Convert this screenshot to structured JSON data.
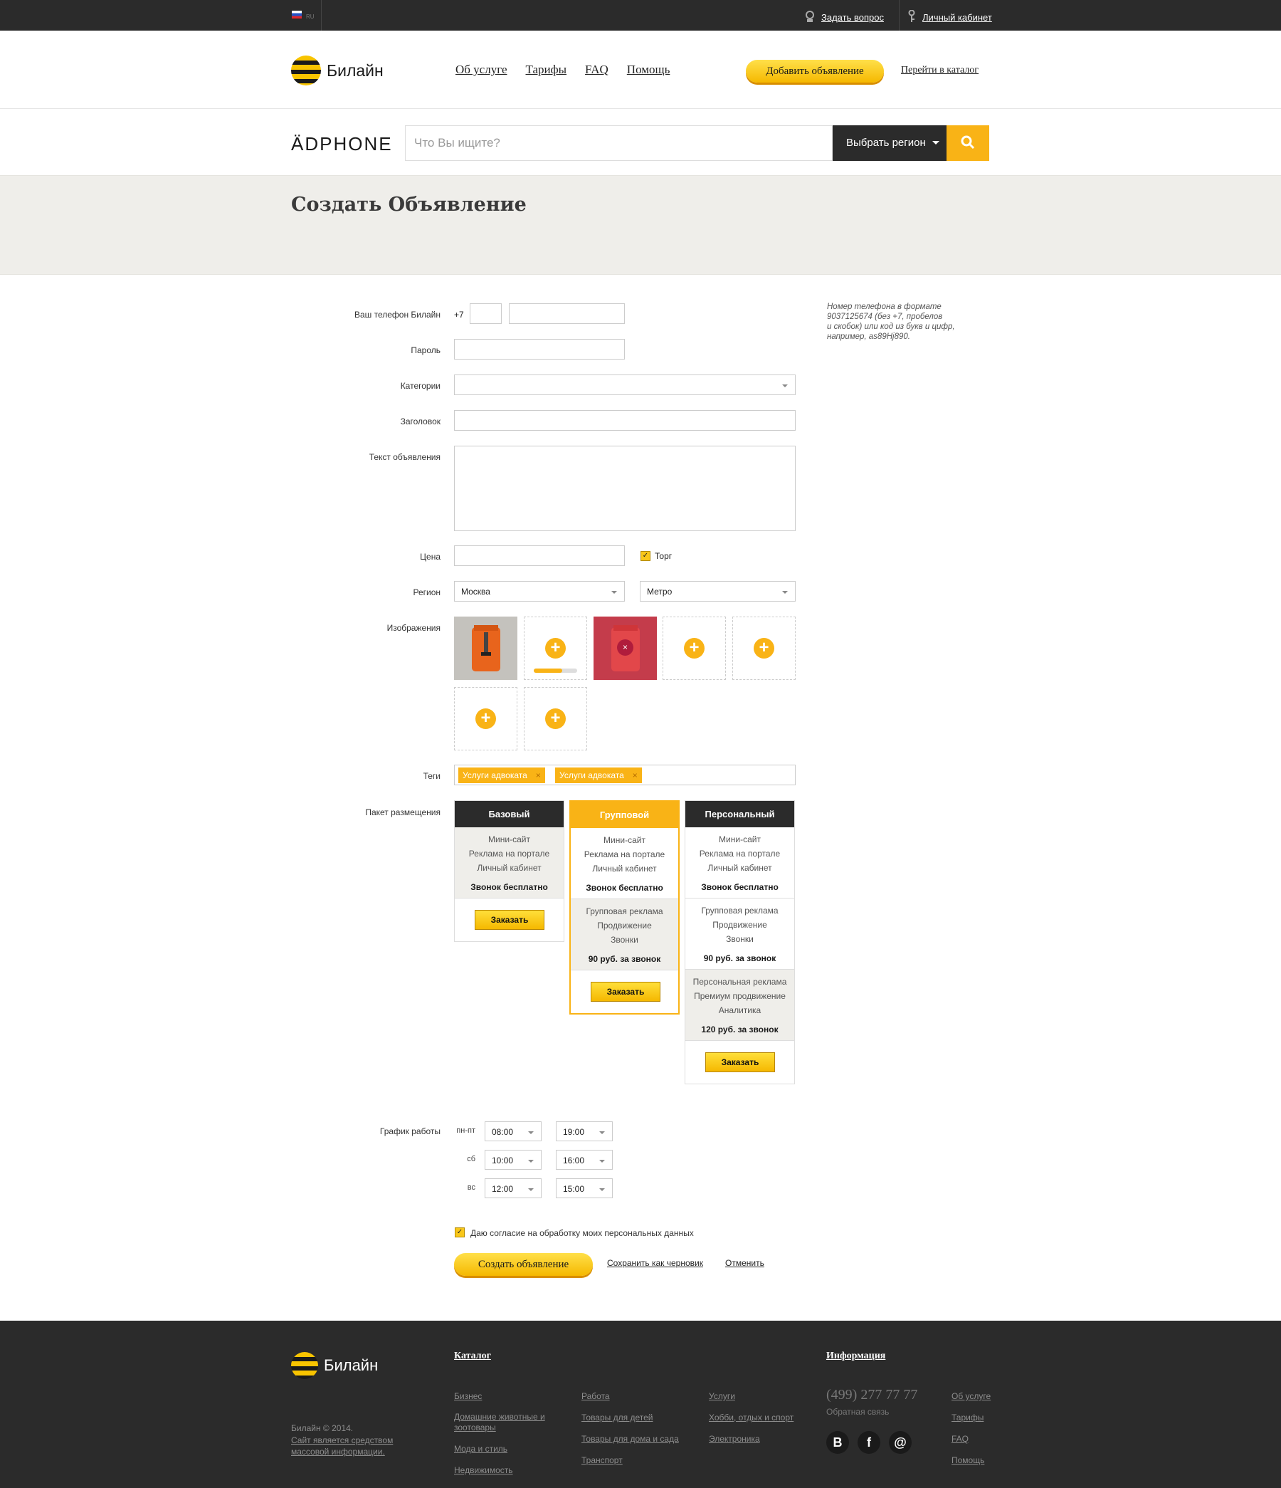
{
  "topbar": {
    "lang": "RU",
    "ask": "Задать вопрос",
    "cabinet": "Личный кабинет"
  },
  "header": {
    "logo": "Билайн",
    "nav": [
      "Об услуге",
      "Тарифы",
      "FAQ",
      "Помощь"
    ],
    "add_button": "Добавить объявление",
    "catalog_link": "Перейти в каталог"
  },
  "search": {
    "brand": "ÄDPHONE",
    "placeholder": "Что Вы ищите?",
    "region_button": "Выбрать регион"
  },
  "page": {
    "title": "Создать Объявление"
  },
  "form": {
    "phone_label": "Ваш телефон Билайн",
    "phone_prefix": "+7",
    "phone_hint": [
      "Номер телефона в формате",
      "9037125674 (без +7, пробелов",
      "и скобок) или код из букв и цифр,",
      "например, as89Hj890."
    ],
    "password_label": "Пароль",
    "category_label": "Категории",
    "title_label": "Заголовок",
    "text_label": "Текст объявления",
    "price_label": "Цена",
    "bargain_label": "Торг",
    "region_label": "Регион",
    "region_value": "Москва",
    "metro_value": "Метро",
    "images_label": "Изображения",
    "upload_progress": 0.65,
    "tags_label": "Теги",
    "tags": [
      "Услуги адвоката",
      "Услуги адвоката"
    ],
    "package_label": "Пакет размещения",
    "packages": [
      {
        "name": "Базовый",
        "basic": [
          "Мини-сайт",
          "Реклама на портале",
          "Личный кабинет"
        ],
        "basic_price": "Звонок бесплатно",
        "order": "Заказать"
      },
      {
        "name": "Групповой",
        "basic": [
          "Мини-сайт",
          "Реклама на портале",
          "Личный кабинет"
        ],
        "basic_price": "Звонок бесплатно",
        "group": [
          "Групповая реклама",
          "Продвижение",
          "Звонки"
        ],
        "group_price": "90 руб. за звонок",
        "order": "Заказать"
      },
      {
        "name": "Персональный",
        "basic": [
          "Мини-сайт",
          "Реклама на портале",
          "Личный кабинет"
        ],
        "basic_price": "Звонок бесплатно",
        "group": [
          "Групповая реклама",
          "Продвижение",
          "Звонки"
        ],
        "group_price": "90 руб. за звонок",
        "personal": [
          "Персональная реклама",
          "Премиум продвижение",
          "Аналитика"
        ],
        "personal_price": "120 руб. за звонок",
        "order": "Заказать"
      }
    ],
    "schedule_label": "График работы",
    "schedule": [
      {
        "day": "пн-пт",
        "from": "08:00",
        "to": "19:00"
      },
      {
        "day": "сб",
        "from": "10:00",
        "to": "16:00"
      },
      {
        "day": "вс",
        "from": "12:00",
        "to": "15:00"
      }
    ],
    "consent": "Даю согласие на обработку моих персональных данных",
    "submit": "Создать объявление",
    "draft": "Сохранить как черновик",
    "cancel": "Отменить"
  },
  "footer": {
    "logo": "Билайн",
    "copyright": "Билайн © 2014.",
    "smi": [
      "Сайт является средством",
      "массовой информации."
    ],
    "catalog_title": "Каталог",
    "col1": [
      "Бизнес",
      "Домашние животные и",
      "зоотовары",
      "Мода и стиль",
      "Недвижимость"
    ],
    "col2": [
      "Работа",
      "Товары для детей",
      "Товары для дома и сада",
      "Транспорт"
    ],
    "col3": [
      "Услуги",
      "Хобби, отдых и спорт",
      "Электроника"
    ],
    "info_title": "Информация",
    "phone": "(499) 277 77 77",
    "feedback": "Обратная связь",
    "info_links": [
      "Об услуге",
      "Тарифы",
      "FAQ",
      "Помощь"
    ],
    "social": [
      "B",
      "f",
      "@"
    ]
  }
}
